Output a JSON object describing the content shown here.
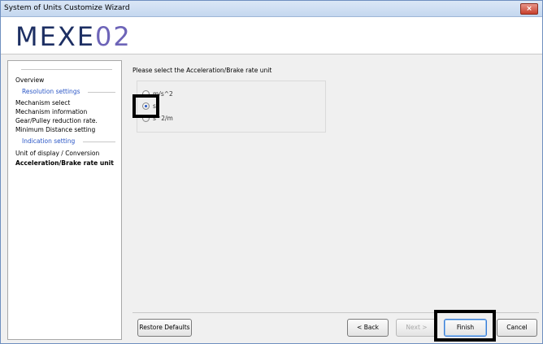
{
  "window": {
    "title": "System of Units Customize Wizard",
    "close_icon": "×"
  },
  "logo": {
    "main": "MEXE",
    "suffix": "02"
  },
  "sidebar": {
    "overview": "Overview",
    "group_resolution": "Resolution settings",
    "mechanism_select": "Mechanism select",
    "mechanism_information": "Mechanism information",
    "gear_pulley": "Gear/Pulley reduction rate.",
    "minimum_distance": "Minimum Distance setting",
    "group_indication": "Indication setting",
    "unit_display": "Unit of display / Conversion",
    "acceleration_unit": "Acceleration/Brake rate unit"
  },
  "main": {
    "prompt": "Please select the Acceleration/Brake rate unit",
    "options": [
      "m/s^2",
      "s",
      "s^2/m"
    ],
    "selected": "s"
  },
  "footer": {
    "restore_defaults": "Restore Defaults",
    "back": "< Back",
    "next": "Next >",
    "finish": "Finish",
    "cancel": "Cancel"
  },
  "colors": {
    "accent": "#2a56c6",
    "logo": "#1d2f63",
    "logo_suffix": "#6d64b8",
    "close": "#c7402d"
  }
}
